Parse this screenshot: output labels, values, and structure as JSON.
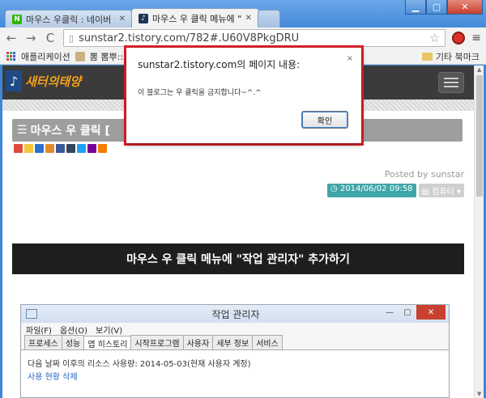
{
  "browser": {
    "tabs": [
      {
        "title": "마우스 우클릭 : 네이버 블",
        "favicon": "N",
        "active": false
      },
      {
        "title": "마우스 우 클릭 메뉴에 \"조",
        "favicon": "♪",
        "active": true
      }
    ],
    "address": "sunstar2.tistory.com/782#.U60V8PkgDRU",
    "bookmarks": {
      "apps_label": "애플리케이션",
      "item1": "뽐 뽐뿌::기타",
      "other_label": "기타 북마크"
    }
  },
  "blog": {
    "logo_text": "새터의태양",
    "post_title": "마우스 우 클릭 [",
    "posted_by": "Posted by sunstar",
    "date": "2014/06/02 09:58",
    "category": "컴퓨터",
    "heading": "마우스 우 클릭 메뉴에 \"작업 관리자\" 추가하기",
    "share_colors": [
      "#dd4b39",
      "#f5c53a",
      "#2f6fd0",
      "#e08a2b",
      "#3b5998",
      "#35465c",
      "#1da1f2",
      "#7b0099",
      "#f57d00"
    ]
  },
  "task_manager": {
    "title": "작업 관리자",
    "menu": [
      "파일(F)",
      "옵션(O)",
      "보기(V)"
    ],
    "tabs": [
      "프로세스",
      "성능",
      "앱 히스토리",
      "시작프로그램",
      "사용자",
      "세부 정보",
      "서비스"
    ],
    "selected_tab": "앱 히스토리",
    "body_text": "다음 날짜 이후의 리소스 사용량: 2014-05-03(현재 사용자 계정)",
    "link_text": "사용 현황 삭제"
  },
  "dialog": {
    "title": "sunstar2.tistory.com의 페이지 내용:",
    "message": "이 블로그는 우 클릭을 금지합니다~^.^",
    "ok_label": "확인",
    "close_glyph": "×"
  },
  "colors": {
    "dialog_highlight": "#e0222a",
    "header_bg": "#3b3b3b",
    "date_badge": "#3fa6a8"
  }
}
